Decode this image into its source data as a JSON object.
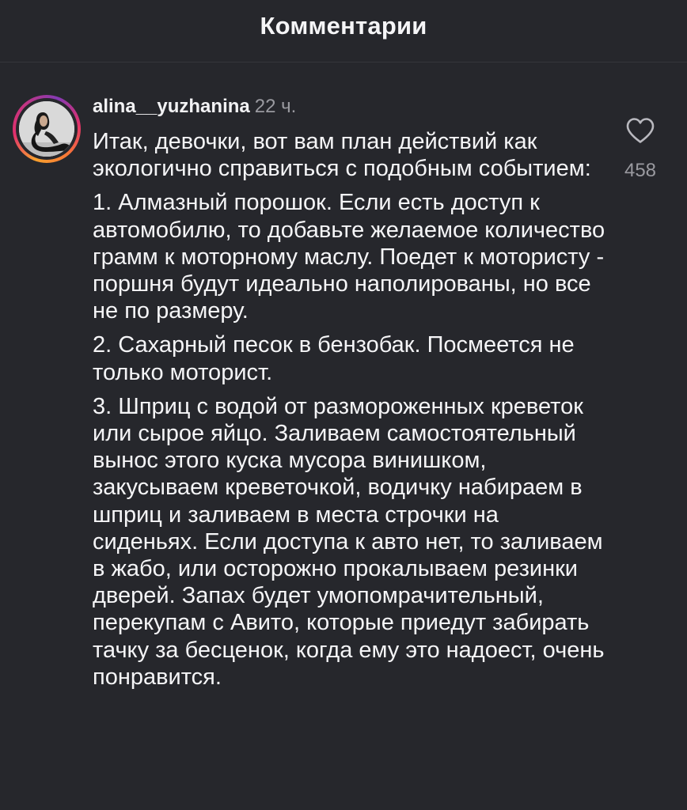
{
  "header": {
    "title": "Комментарии"
  },
  "comment": {
    "username": "alina__yuzhanina",
    "time": "22 ч.",
    "like_count": "458",
    "paragraphs": [
      "Итак, девочки, вот вам план действий как экологично справиться с подобным событием:",
      "1. Алмазный порошок. Если есть доступ к автомобилю, то добавьте желаемое количество грамм к моторному маслу. Поедет к мотористу - поршня будут идеально наполированы, но все не по размеру.",
      "2. Сахарный песок в бензобак. Посмеется не только моторист.",
      "3. Шприц с водой от размороженных креветок или сырое яйцо. Заливаем самостоятельный вынос этого куска мусора винишком, закусываем креветочкой, водичку набираем в шприц и заливаем в места строчки на сиденьях. Если доступа к авто нет, то заливаем в жабо, или осторожно прокалываем резинки дверей. Запах будет умопомрачительный, перекупам с Авито, которые приедут забирать тачку за бесценок, когда ему это надоест, очень понравится."
    ],
    "icons": {
      "like": "heart-outline-icon",
      "avatar": "user-avatar"
    }
  }
}
